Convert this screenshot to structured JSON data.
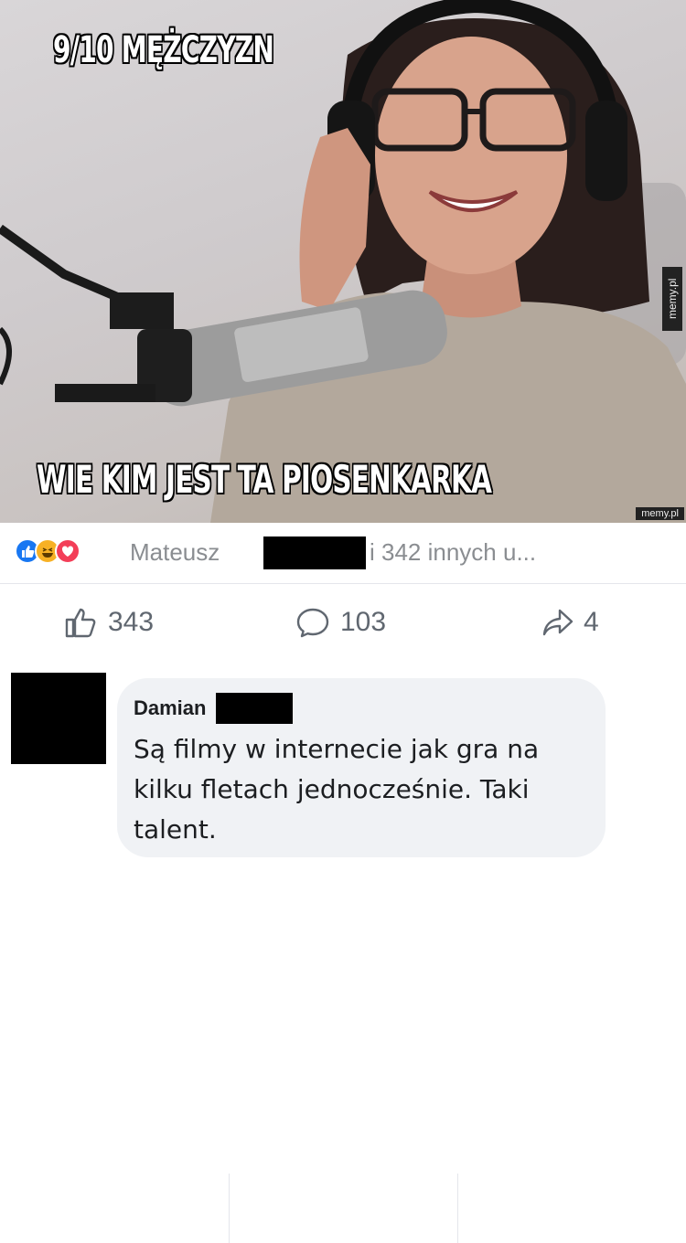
{
  "meme": {
    "top_text": "9/10 MĘŻCZYZN",
    "bottom_text": "WIE KIM JEST TA PIOSENKARKA",
    "watermark_side": "memy.pl",
    "watermark_bottom": "memy.pl"
  },
  "reactions": {
    "icons": [
      "like-icon",
      "haha-icon",
      "love-icon"
    ],
    "name": "Mateusz",
    "others": "i 342 innych u..."
  },
  "actions": {
    "likes": "343",
    "comments": "103",
    "shares": "4"
  },
  "comment": {
    "author": "Damian",
    "text": "Są filmy w internecie jak gra na kilku fletach jednocześnie. Taki talent."
  },
  "colors": {
    "like_blue": "#1877f2",
    "haha_yellow": "#f7b125",
    "love_red": "#f33e58",
    "muted_text": "#606770",
    "bubble_bg": "#f0f2f5"
  }
}
